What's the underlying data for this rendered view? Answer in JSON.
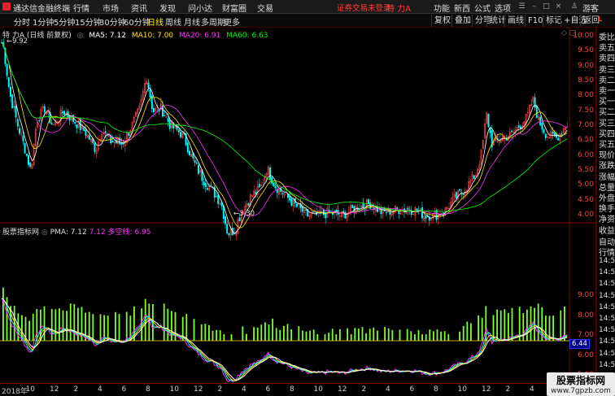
{
  "app": {
    "name": "通达信金融终端"
  },
  "menu": [
    "行情",
    "市场",
    "资讯",
    "发现",
    "问小达",
    "财富圈",
    "交易"
  ],
  "status_warning": "证券交易未登录",
  "stock_name": "特 力A",
  "right_menu": [
    "功能",
    "新西",
    "公式",
    "选项"
  ],
  "guest_label": "游客",
  "periods": [
    {
      "label": "分时",
      "active": false
    },
    {
      "label": "1分钟",
      "active": false
    },
    {
      "label": "5分钟",
      "active": false
    },
    {
      "label": "15分钟",
      "active": false
    },
    {
      "label": "30分钟",
      "active": false
    },
    {
      "label": "60分钟",
      "active": false
    },
    {
      "label": "日线",
      "active": true
    },
    {
      "label": "周线",
      "active": false
    },
    {
      "label": "月线",
      "active": false
    },
    {
      "label": "多周期",
      "active": false
    },
    {
      "label": "更多",
      "active": false
    }
  ],
  "tool_buttons": [
    "复权",
    "叠加",
    "分笔",
    "统计",
    "画线",
    "F10",
    "标记",
    "+自选",
    "返回"
  ],
  "kline_info": {
    "name": "特 力A (日线 前复权)",
    "ma5": "MA5: 7.12",
    "ma10": "MA10: 7.00",
    "ma20": "MA20: 6.91",
    "ma60": "MA60: 6.63",
    "max_label": "9.92",
    "min_label": "3.30"
  },
  "colors": {
    "ma5": "#ffffff",
    "ma10": "#ffe600",
    "ma20": "#ff33ff",
    "ma60": "#00ff00",
    "up": "#ff4040",
    "down": "#00ffff",
    "bar": "#7cff2a",
    "accent": "#ff3b3b"
  },
  "price_axis": [
    "10.00",
    "9.50",
    "9.00",
    "8.50",
    "8.00",
    "7.50",
    "7.00",
    "6.50",
    "6.00",
    "5.50",
    "5.00",
    "4.50",
    "4.00"
  ],
  "indicator": {
    "name": "股票指标网",
    "pma": "PMA: 7.12",
    "v2": "7.12",
    "dkx": "多空线: 6.95",
    "current": "6.44"
  },
  "indicator_axis": [
    "9.00",
    "8.00",
    "7.00",
    "6.00",
    "5.00"
  ],
  "right_panel": {
    "top_labels": [
      "委比",
      "卖五",
      "卖四",
      "卖三",
      "卖二",
      "卖一",
      "买一",
      "买二",
      "买三",
      "买四",
      "买五",
      "现价",
      "涨跌",
      "涨幅",
      "总量",
      "外盘",
      "换手",
      "净资",
      "收益"
    ],
    "bottom_labels": [
      "自动",
      "行情"
    ],
    "times": [
      "14:55",
      "14:55",
      "14:55",
      "14:56",
      "14:56",
      "14:56",
      "14:56",
      "14:56",
      "14:56",
      "14:56"
    ],
    "l_label": "L"
  },
  "x_axis": [
    "2018年",
    "10",
    "12",
    "2",
    "4",
    "6",
    "8",
    "10",
    "12",
    "2",
    "4",
    "6",
    "8",
    "10",
    "12",
    "2",
    "4",
    "6",
    "8",
    "10",
    "12",
    "2",
    "4",
    "6"
  ],
  "watermark": {
    "title": "股票指标网",
    "url": "www.7gpzb.com"
  }
}
